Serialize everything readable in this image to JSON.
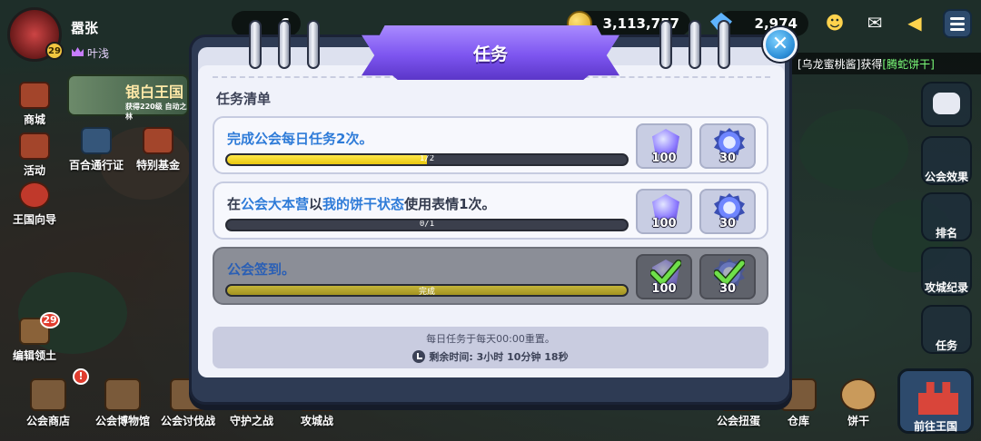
{
  "player": {
    "name": "嚣张",
    "level": "29",
    "guild": "叶浅"
  },
  "currencies": {
    "coins": "3,113,757",
    "gems": "2,974"
  },
  "top_badge": "6",
  "notice": {
    "user": "[乌龙蜜桃酱]",
    "verb": "获得",
    "item": "[腾蛇饼干]"
  },
  "left_menu": {
    "shop": "商城",
    "event": "活动",
    "guide": "王国向导",
    "edit": "编辑领土",
    "edit_badge": "29",
    "banner_title": "银白王国",
    "banner_sub": "获得220级 自动之林",
    "pass": "百合通行证",
    "fund": "特别基金"
  },
  "right_menu": {
    "effect": "公会效果",
    "rank": "排名",
    "siege": "攻城纪录",
    "task": "任务"
  },
  "bottom_menu": {
    "guild_shop": "公会商店",
    "museum": "公会博物馆",
    "raid": "公会讨伐战",
    "defense": "守护之战",
    "siege": "攻城战",
    "gacha": "公会扭蛋",
    "storage": "仓库",
    "cookie": "饼干",
    "home": "前往王国"
  },
  "modal": {
    "title": "任务",
    "close": "✕",
    "section": "任务清单",
    "tasks": [
      {
        "parts": [
          "完成公会每日任务2次。",
          "",
          "",
          "",
          ""
        ],
        "progress_label": "1/2",
        "progress": 0.5,
        "rewards": [
          "100",
          "30"
        ],
        "done": false
      },
      {
        "parts": [
          "在",
          "公会大本营",
          "以",
          "我的饼干状态",
          "使用表情1次。"
        ],
        "progress_label": "0/1",
        "progress": 0,
        "rewards": [
          "100",
          "30"
        ],
        "done": false
      },
      {
        "parts": [
          "公会签到。",
          "",
          "",
          "",
          ""
        ],
        "progress_label": "完成",
        "progress": 1,
        "rewards": [
          "100",
          "30"
        ],
        "done": true
      }
    ],
    "footer_reset": "每日任务于每天00:00重置。",
    "footer_remaining": "剩余时间: 3小时 10分钟 18秒"
  },
  "icons": [
    "crown-icon",
    "coin-icon",
    "gem-icon",
    "mail-icon",
    "menu-icon",
    "gem-reward-icon",
    "medal-icon",
    "check-icon",
    "clock-icon",
    "close-icon"
  ]
}
